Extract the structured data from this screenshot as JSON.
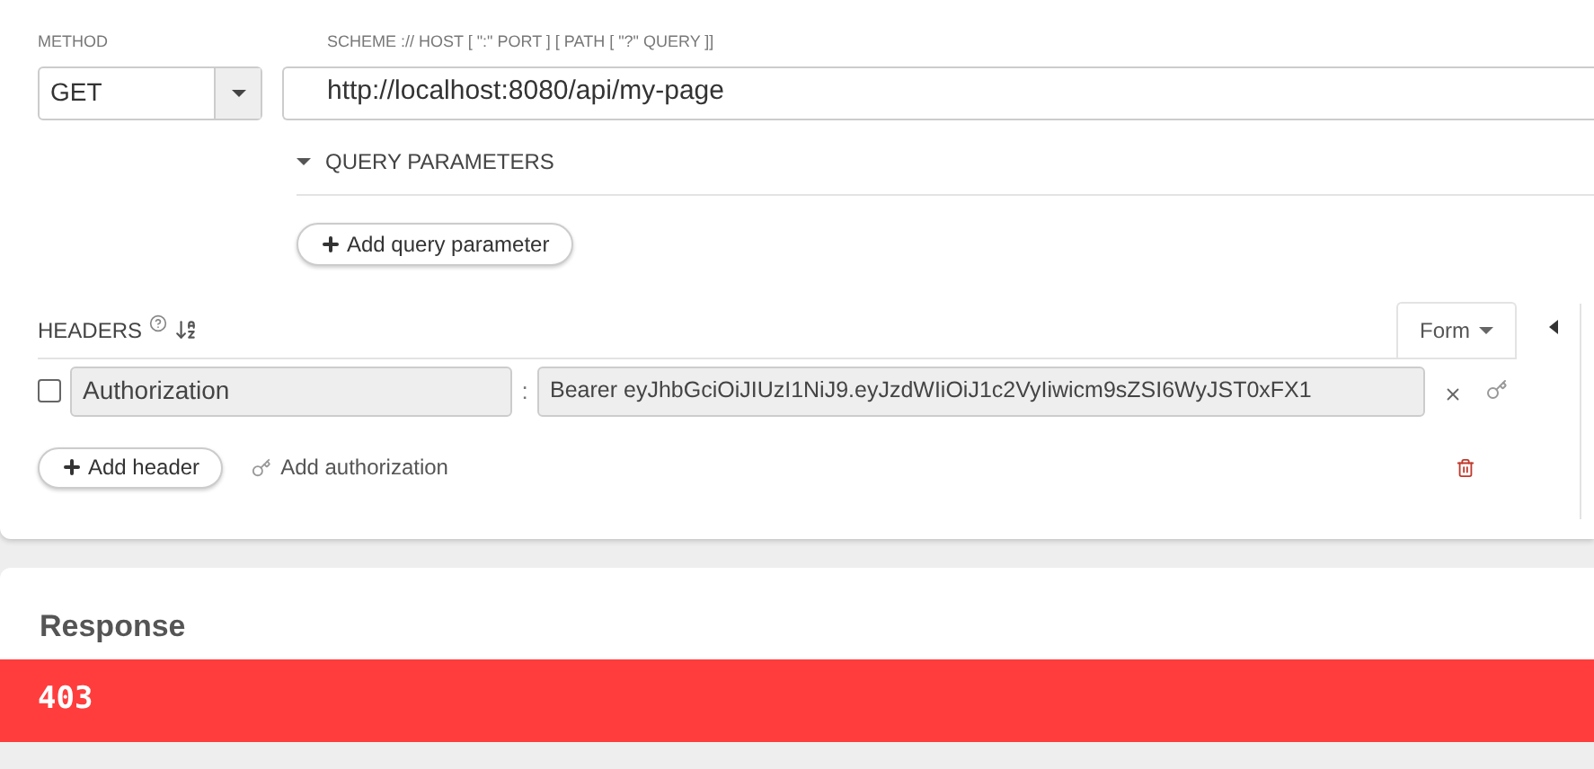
{
  "request": {
    "method_label": "METHOD",
    "method": "GET",
    "url_label": "SCHEME :// HOST [ \":\" PORT ] [ PATH [ \"?\" QUERY ]]",
    "url": "http://localhost:8080/api/my-page"
  },
  "query_parameters": {
    "title": "QUERY PARAMETERS",
    "expanded": true,
    "add_button": "Add query parameter"
  },
  "headers": {
    "title": "HEADERS",
    "mode": "Form",
    "rows": [
      {
        "checked": false,
        "key": "Authorization",
        "separator": ":",
        "value": "Bearer eyJhbGciOiJIUzI1NiJ9.eyJzdWIiOiJ1c2VyIiwicm9sZSI6WyJST0xFX1"
      }
    ],
    "add_button": "Add header",
    "add_authorization": "Add authorization"
  },
  "response": {
    "title": "Response",
    "status": "403"
  }
}
